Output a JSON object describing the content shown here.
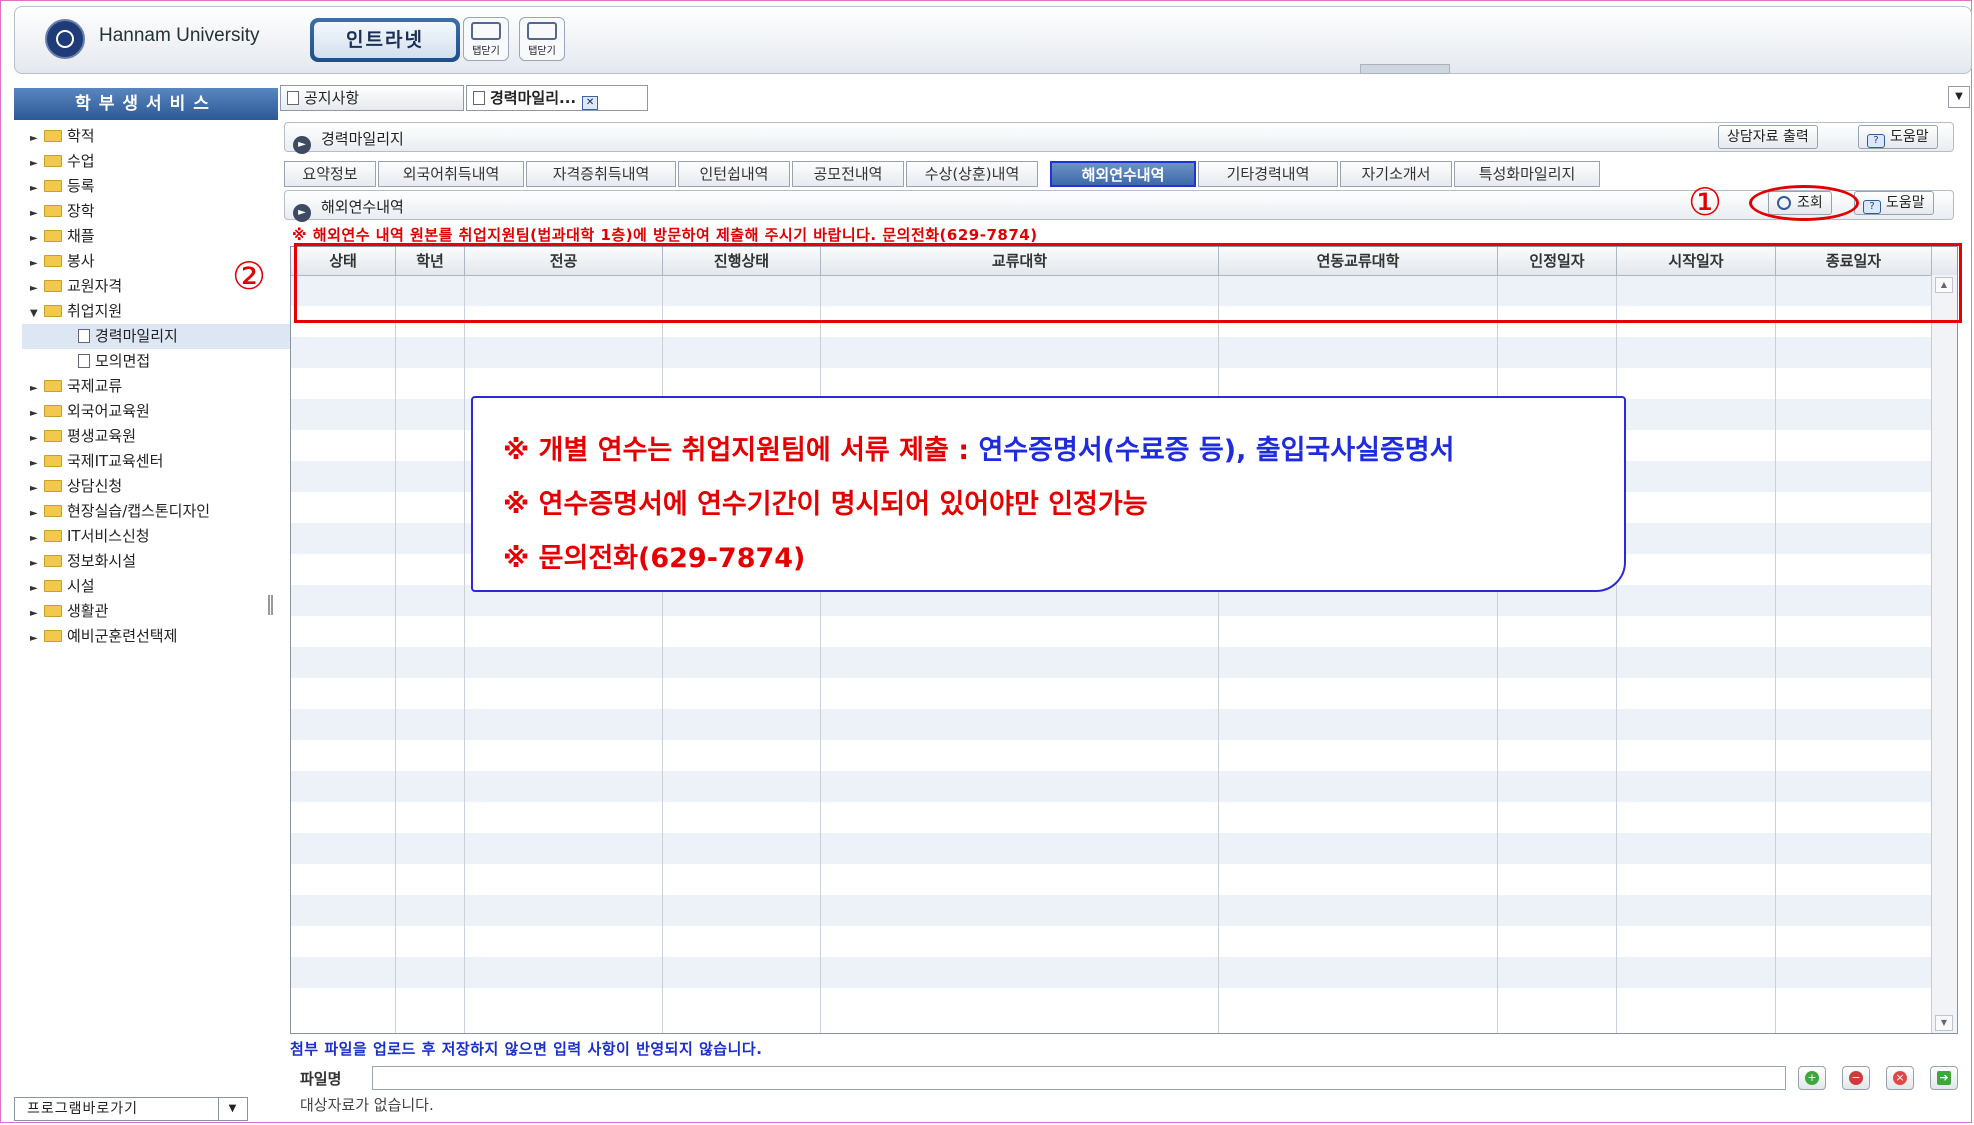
{
  "header": {
    "brand": "Hannam University",
    "intranet_label": "인트라넷",
    "tab_close_label": "탭닫기",
    "tab_close_label2": "탭닫기"
  },
  "sidebar": {
    "title": "학부생서비스",
    "items": [
      {
        "label": "학적"
      },
      {
        "label": "수업"
      },
      {
        "label": "등록"
      },
      {
        "label": "장학"
      },
      {
        "label": "채플"
      },
      {
        "label": "봉사"
      },
      {
        "label": "교원자격"
      },
      {
        "label": "취업지원"
      },
      {
        "label": "경력마일리지"
      },
      {
        "label": "모의면접"
      },
      {
        "label": "국제교류"
      },
      {
        "label": "외국어교육원"
      },
      {
        "label": "평생교육원"
      },
      {
        "label": "국제IT교육센터"
      },
      {
        "label": "상담신청"
      },
      {
        "label": "현장실습/캡스톤디자인"
      },
      {
        "label": "IT서비스신청"
      },
      {
        "label": "정보화시설"
      },
      {
        "label": "시설"
      },
      {
        "label": "생활관"
      },
      {
        "label": "예비군훈련선택제"
      }
    ],
    "program_shortcut": "프로그램바로가기"
  },
  "tabs": {
    "notice": "공지사항",
    "mileage": "경력마일리..."
  },
  "panel": {
    "title": "경력마일리지",
    "counsel_print": "상담자료 출력",
    "help": "도움말"
  },
  "subtabs": [
    "요약정보",
    "외국어취득내역",
    "자격증취득내역",
    "인턴쉽내역",
    "공모전내역",
    "수상(상훈)내역",
    "해외연수내역",
    "기타경력내역",
    "자기소개서",
    "특성화마일리지"
  ],
  "section": {
    "title": "해외연수내역",
    "search": "조회",
    "help": "도움말"
  },
  "notice_text": "※ 해외연수 내역 원본를 취업지원팀(법과대학 1층)에 방문하여 제출해 주시기 바랍니다. 문의전화(629-7874)",
  "grid": {
    "columns": [
      "상태",
      "학년",
      "전공",
      "진행상태",
      "교류대학",
      "연동교류대학",
      "인정일자",
      "시작일자",
      "종료일자"
    ]
  },
  "annotations": {
    "one": "①",
    "two": "②",
    "callout": {
      "line1_a": "※ 개별 연수는 취업지원팀에 서류 제출 : ",
      "line1_b": "연수증명서(수료증 등), 출입국사실증명서",
      "line2": "※ 연수증명서에 연수기간이 명시되어 있어야만 인정가능",
      "line3": "※ 문의전화(629-7874)"
    }
  },
  "footer": {
    "upload_note": "첨부 파일을 업로드 후 저장하지 않으면 입력 사항이 반영되지 않습니다.",
    "file_label": "파일명",
    "status": "대상자료가 없습니다."
  },
  "colors": {
    "accent": "#3c69a8",
    "annotation_red": "#e00000",
    "annotation_blue": "#1e2be0"
  }
}
